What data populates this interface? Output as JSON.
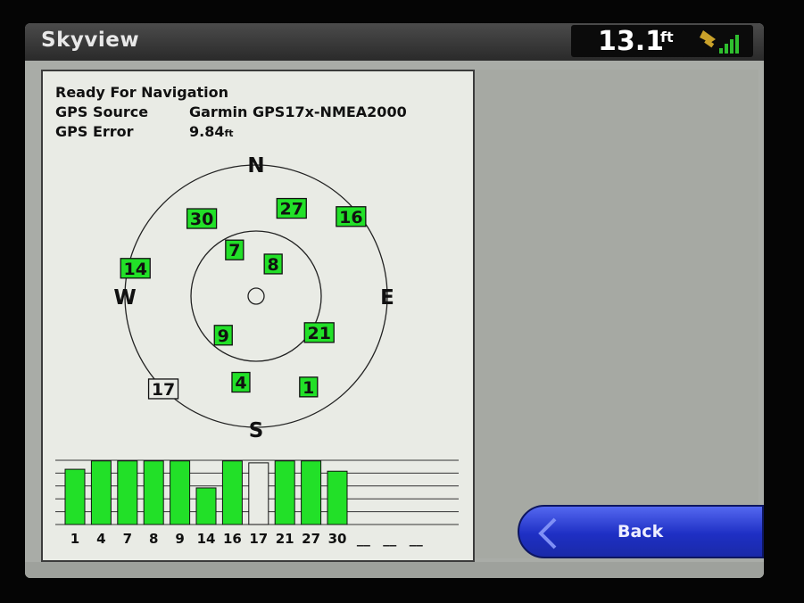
{
  "header": {
    "title": "Skyview",
    "depth_value": "13.1",
    "depth_unit": "ft",
    "gps_signal_icon": "satellite-signal-icon"
  },
  "status": {
    "state": "Ready For Navigation",
    "source_label": "GPS Source",
    "source_value": "Garmin GPS17x-NMEA2000",
    "error_label": "GPS Error",
    "error_value": "9.84",
    "error_unit": "ft"
  },
  "compass": {
    "north": "N",
    "south": "S",
    "east": "E",
    "west": "W"
  },
  "satellites": [
    {
      "id": "30",
      "azimuth": 325,
      "elevation": 25,
      "locked": true
    },
    {
      "id": "27",
      "azimuth": 22,
      "elevation": 25,
      "locked": true
    },
    {
      "id": "16",
      "azimuth": 50,
      "elevation": 5,
      "locked": true
    },
    {
      "id": "7",
      "azimuth": 335,
      "elevation": 55,
      "locked": true
    },
    {
      "id": "8",
      "azimuth": 28,
      "elevation": 65,
      "locked": true
    },
    {
      "id": "14",
      "azimuth": 283,
      "elevation": 5,
      "locked": true
    },
    {
      "id": "9",
      "azimuth": 220,
      "elevation": 55,
      "locked": true
    },
    {
      "id": "21",
      "azimuth": 120,
      "elevation": 40,
      "locked": true
    },
    {
      "id": "4",
      "azimuth": 190,
      "elevation": 30,
      "locked": true
    },
    {
      "id": "1",
      "azimuth": 150,
      "elevation": 18,
      "locked": true
    },
    {
      "id": "17",
      "azimuth": 225,
      "elevation": 0,
      "locked": false
    }
  ],
  "signal_bars": [
    {
      "id": "1",
      "strength": 0.86,
      "locked": true
    },
    {
      "id": "4",
      "strength": 0.99,
      "locked": true
    },
    {
      "id": "7",
      "strength": 0.99,
      "locked": true
    },
    {
      "id": "8",
      "strength": 0.99,
      "locked": true
    },
    {
      "id": "9",
      "strength": 0.99,
      "locked": true
    },
    {
      "id": "14",
      "strength": 0.57,
      "locked": true
    },
    {
      "id": "16",
      "strength": 0.99,
      "locked": true
    },
    {
      "id": "17",
      "strength": 0.96,
      "locked": false
    },
    {
      "id": "21",
      "strength": 0.99,
      "locked": true
    },
    {
      "id": "27",
      "strength": 0.99,
      "locked": true
    },
    {
      "id": "30",
      "strength": 0.83,
      "locked": true
    }
  ],
  "empty_slots": [
    "__",
    "__",
    "__"
  ],
  "buttons": {
    "back_label": "Back"
  },
  "colors": {
    "locked_fill": "#22e028",
    "unlocked_fill": "#e9ebe5",
    "back_button": "#1e2fc4"
  }
}
